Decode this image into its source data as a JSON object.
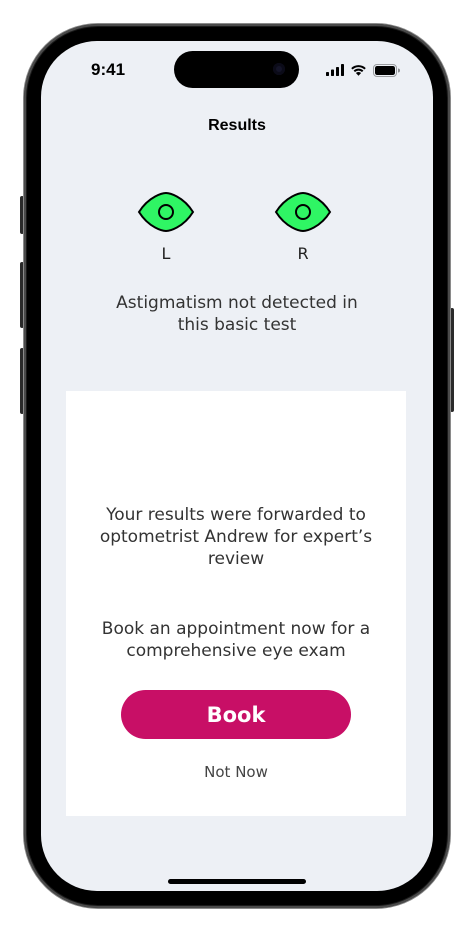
{
  "status_bar": {
    "time": "9:41"
  },
  "header": {
    "title": "Results"
  },
  "eyes": [
    {
      "label": "L",
      "icon": "eye-icon",
      "color": "#2ff564"
    },
    {
      "label": "R",
      "icon": "eye-icon",
      "color": "#2ff564"
    }
  ],
  "result": {
    "text": "Astigmatism not detected in this basic test"
  },
  "card": {
    "forward_message": "Your results were forwarded to optometrist Andrew for expert’s review",
    "book_message": "Book an appointment now for a comprehensive eye exam",
    "book_label": "Book",
    "not_now_label": "Not Now"
  },
  "colors": {
    "accent": "#c80f66",
    "eye_fill": "#2ff564",
    "background": "#edf0f5"
  }
}
